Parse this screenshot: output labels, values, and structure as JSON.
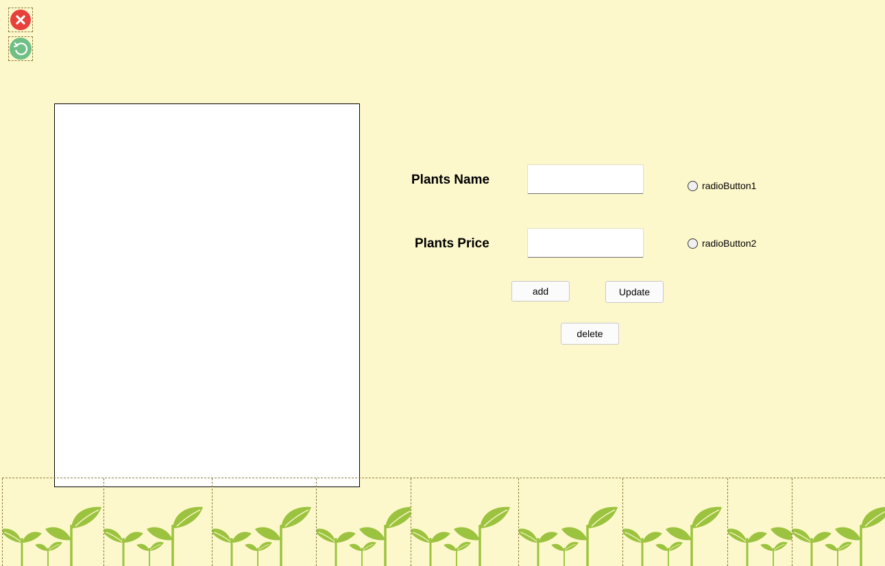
{
  "toolbar": {
    "close_icon": "close-icon",
    "back_icon": "undo-arrow-icon",
    "close_color": "#e8403a",
    "back_color": "#6fbf86"
  },
  "form": {
    "name_label": "Plants Name",
    "name_value": "",
    "price_label": "Plants Price",
    "price_value": "",
    "radio1_label": "radioButton1",
    "radio2_label": "radioButton2",
    "add_label": "add",
    "update_label": "Update",
    "delete_label": "delete"
  },
  "footer": {
    "decoration": "sprout-pattern",
    "sprout_color": "#9bc33f"
  }
}
